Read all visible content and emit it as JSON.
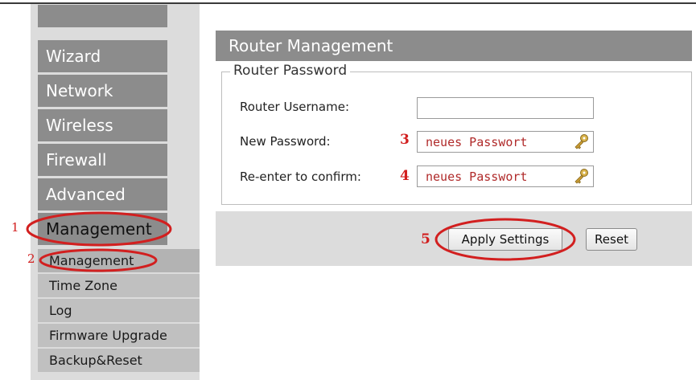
{
  "sidebar": {
    "main_items": [
      {
        "label": "Wizard"
      },
      {
        "label": "Network"
      },
      {
        "label": "Wireless"
      },
      {
        "label": "Firewall"
      },
      {
        "label": "Advanced"
      },
      {
        "label": "Management"
      }
    ],
    "sub_items": [
      {
        "label": "Management"
      },
      {
        "label": "Time Zone"
      },
      {
        "label": "Log"
      },
      {
        "label": "Firmware Upgrade"
      },
      {
        "label": "Backup&Reset"
      }
    ]
  },
  "panel": {
    "title": "Router Management",
    "legend": "Router Password",
    "username_label": "Router Username:",
    "username_value": "",
    "new_password_label": "New Password:",
    "new_password_value": "neues Passwort",
    "confirm_label": "Re-enter to confirm:",
    "confirm_value": "neues Passwort",
    "apply_label": "Apply Settings",
    "reset_label": "Reset"
  },
  "annotations": [
    "1",
    "2",
    "3",
    "4",
    "5"
  ],
  "colors": {
    "menu_bg": "#8c8c8c",
    "submenu_bg": "#c0c0c0",
    "annotation_red": "#d21f1f"
  }
}
